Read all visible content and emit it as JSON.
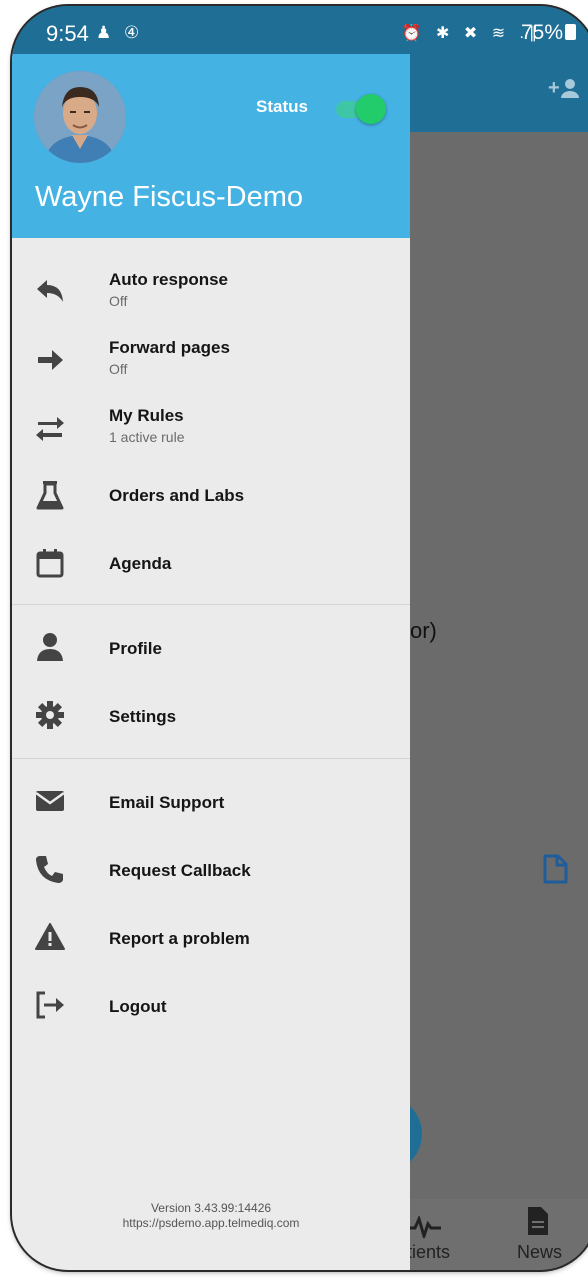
{
  "status_bar": {
    "time": "9:54",
    "left_icons": "♟ ④",
    "right_icons": "⏰ ✱ ✖ ≋ .∥",
    "battery": "75%"
  },
  "drawer": {
    "status_label": "Status",
    "status_on": true,
    "user_name": "Wayne Fiscus-Demo",
    "menu": [
      {
        "label": "Auto response",
        "sub": "Off"
      },
      {
        "label": "Forward pages",
        "sub": "Off"
      },
      {
        "label": "My Rules",
        "sub": "1 active rule"
      },
      {
        "label": "Orders and Labs"
      },
      {
        "label": "Agenda"
      },
      {
        "label": "Profile"
      },
      {
        "label": "Settings"
      },
      {
        "label": "Email Support"
      },
      {
        "label": "Request Callback"
      },
      {
        "label": "Report a problem"
      },
      {
        "label": "Logout"
      }
    ],
    "version_line1": "Version 3.43.99:14426",
    "version_line2": "https://psdemo.app.telmediq.com"
  },
  "background": {
    "partial_text": "or)",
    "nav_patients": "tients",
    "nav_news": "News"
  },
  "colors": {
    "header_blue": "#45b2e4",
    "appbar_blue": "#1e6e95",
    "toggle_green": "#22cc6a",
    "drawer_bg": "#ebebeb"
  }
}
